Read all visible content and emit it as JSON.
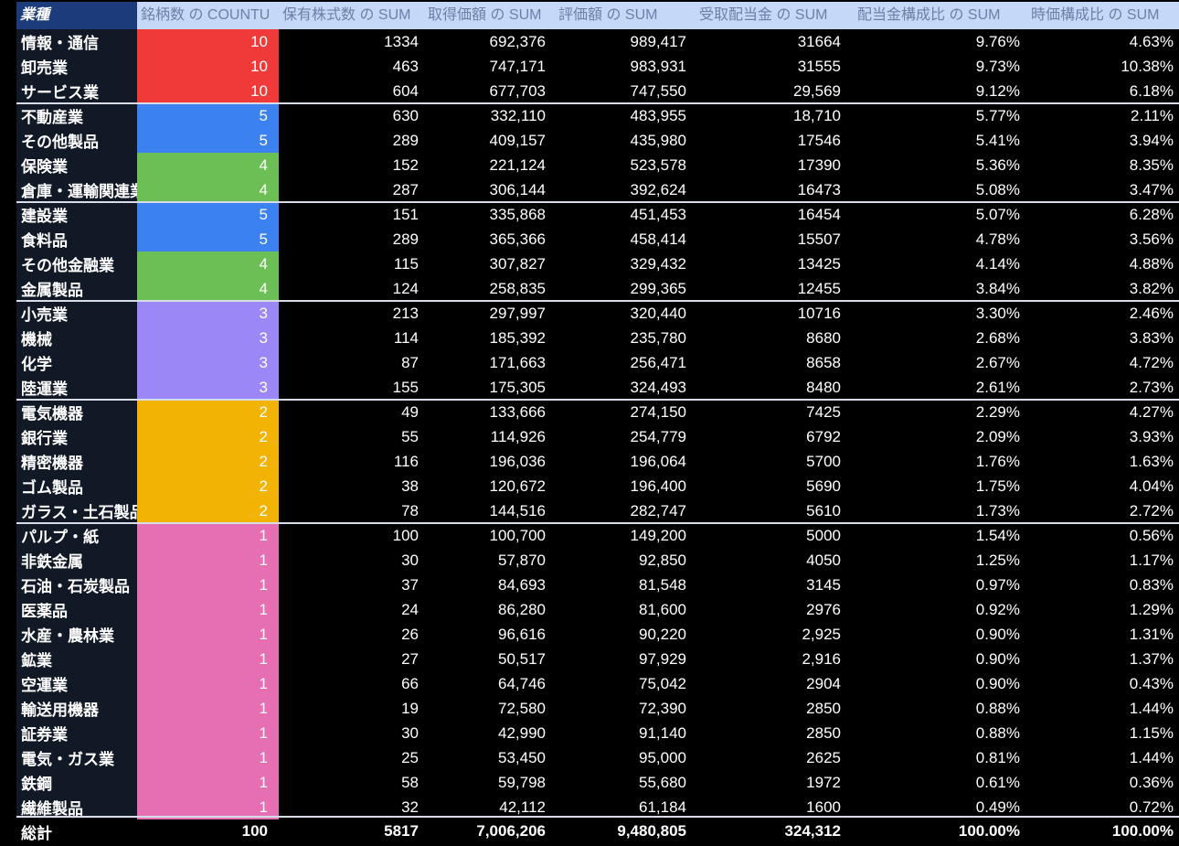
{
  "header": [
    "業種",
    "銘柄数 の COUNTU",
    "保有株式数 の SUM",
    "取得価額 の SUM",
    "評価額 の SUM",
    "受取配当金 の SUM",
    "配当金構成比 の SUM",
    "時価構成比 の SUM"
  ],
  "group_colors": {
    "10": "#f03a3a",
    "5": "#3b82f0",
    "4": "#6cbf54",
    "3": "#9b87f5",
    "2": "#f2b304",
    "1": "#e66fb4"
  },
  "rows": [
    {
      "sector": "情報・通信",
      "count": "10",
      "shares": "1334",
      "cost": "692,376",
      "value": "989,417",
      "dividend": "31664",
      "div_ratio": "9.76%",
      "mkt_ratio": "4.63%"
    },
    {
      "sector": "卸売業",
      "count": "10",
      "shares": "463",
      "cost": "747,171",
      "value": "983,931",
      "dividend": "31555",
      "div_ratio": "9.73%",
      "mkt_ratio": "10.38%"
    },
    {
      "sector": "サービス業",
      "count": "10",
      "shares": "604",
      "cost": "677,703",
      "value": "747,550",
      "dividend": "29,569",
      "div_ratio": "9.12%",
      "mkt_ratio": "6.18%"
    },
    {
      "sector": "不動産業",
      "count": "5",
      "shares": "630",
      "cost": "332,110",
      "value": "483,955",
      "dividend": "18,710",
      "div_ratio": "5.77%",
      "mkt_ratio": "2.11%"
    },
    {
      "sector": "その他製品",
      "count": "5",
      "shares": "289",
      "cost": "409,157",
      "value": "435,980",
      "dividend": "17546",
      "div_ratio": "5.41%",
      "mkt_ratio": "3.94%"
    },
    {
      "sector": "保険業",
      "count": "4",
      "shares": "152",
      "cost": "221,124",
      "value": "523,578",
      "dividend": "17390",
      "div_ratio": "5.36%",
      "mkt_ratio": "8.35%"
    },
    {
      "sector": "倉庫・運輸関連業",
      "count": "4",
      "shares": "287",
      "cost": "306,144",
      "value": "392,624",
      "dividend": "16473",
      "div_ratio": "5.08%",
      "mkt_ratio": "3.47%"
    },
    {
      "sector": "建設業",
      "count": "5",
      "shares": "151",
      "cost": "335,868",
      "value": "451,453",
      "dividend": "16454",
      "div_ratio": "5.07%",
      "mkt_ratio": "6.28%"
    },
    {
      "sector": "食料品",
      "count": "5",
      "shares": "289",
      "cost": "365,366",
      "value": "458,414",
      "dividend": "15507",
      "div_ratio": "4.78%",
      "mkt_ratio": "3.56%"
    },
    {
      "sector": "その他金融業",
      "count": "4",
      "shares": "115",
      "cost": "307,827",
      "value": "329,432",
      "dividend": "13425",
      "div_ratio": "4.14%",
      "mkt_ratio": "4.88%"
    },
    {
      "sector": "金属製品",
      "count": "4",
      "shares": "124",
      "cost": "258,835",
      "value": "299,365",
      "dividend": "12455",
      "div_ratio": "3.84%",
      "mkt_ratio": "3.82%"
    },
    {
      "sector": "小売業",
      "count": "3",
      "shares": "213",
      "cost": "297,997",
      "value": "320,440",
      "dividend": "10716",
      "div_ratio": "3.30%",
      "mkt_ratio": "2.46%"
    },
    {
      "sector": "機械",
      "count": "3",
      "shares": "114",
      "cost": "185,392",
      "value": "235,780",
      "dividend": "8680",
      "div_ratio": "2.68%",
      "mkt_ratio": "3.83%"
    },
    {
      "sector": "化学",
      "count": "3",
      "shares": "87",
      "cost": "171,663",
      "value": "256,471",
      "dividend": "8658",
      "div_ratio": "2.67%",
      "mkt_ratio": "4.72%"
    },
    {
      "sector": "陸運業",
      "count": "3",
      "shares": "155",
      "cost": "175,305",
      "value": "324,493",
      "dividend": "8480",
      "div_ratio": "2.61%",
      "mkt_ratio": "2.73%"
    },
    {
      "sector": "電気機器",
      "count": "2",
      "shares": "49",
      "cost": "133,666",
      "value": "274,150",
      "dividend": "7425",
      "div_ratio": "2.29%",
      "mkt_ratio": "4.27%"
    },
    {
      "sector": "銀行業",
      "count": "2",
      "shares": "55",
      "cost": "114,926",
      "value": "254,779",
      "dividend": "6792",
      "div_ratio": "2.09%",
      "mkt_ratio": "3.93%"
    },
    {
      "sector": "精密機器",
      "count": "2",
      "shares": "116",
      "cost": "196,036",
      "value": "196,064",
      "dividend": "5700",
      "div_ratio": "1.76%",
      "mkt_ratio": "1.63%"
    },
    {
      "sector": "ゴム製品",
      "count": "2",
      "shares": "38",
      "cost": "120,672",
      "value": "196,400",
      "dividend": "5690",
      "div_ratio": "1.75%",
      "mkt_ratio": "4.04%"
    },
    {
      "sector": "ガラス・土石製品",
      "count": "2",
      "shares": "78",
      "cost": "144,516",
      "value": "282,747",
      "dividend": "5610",
      "div_ratio": "1.73%",
      "mkt_ratio": "2.72%"
    },
    {
      "sector": "パルプ・紙",
      "count": "1",
      "shares": "100",
      "cost": "100,700",
      "value": "149,200",
      "dividend": "5000",
      "div_ratio": "1.54%",
      "mkt_ratio": "0.56%"
    },
    {
      "sector": "非鉄金属",
      "count": "1",
      "shares": "30",
      "cost": "57,870",
      "value": "92,850",
      "dividend": "4050",
      "div_ratio": "1.25%",
      "mkt_ratio": "1.17%"
    },
    {
      "sector": "石油・石炭製品",
      "count": "1",
      "shares": "37",
      "cost": "84,693",
      "value": "81,548",
      "dividend": "3145",
      "div_ratio": "0.97%",
      "mkt_ratio": "0.83%"
    },
    {
      "sector": "医薬品",
      "count": "1",
      "shares": "24",
      "cost": "86,280",
      "value": "81,600",
      "dividend": "2976",
      "div_ratio": "0.92%",
      "mkt_ratio": "1.29%"
    },
    {
      "sector": "水産・農林業",
      "count": "1",
      "shares": "26",
      "cost": "96,616",
      "value": "90,220",
      "dividend": "2,925",
      "div_ratio": "0.90%",
      "mkt_ratio": "1.31%"
    },
    {
      "sector": "鉱業",
      "count": "1",
      "shares": "27",
      "cost": "50,517",
      "value": "97,929",
      "dividend": "2,916",
      "div_ratio": "0.90%",
      "mkt_ratio": "1.37%"
    },
    {
      "sector": "空運業",
      "count": "1",
      "shares": "66",
      "cost": "64,746",
      "value": "75,042",
      "dividend": "2904",
      "div_ratio": "0.90%",
      "mkt_ratio": "0.43%"
    },
    {
      "sector": "輸送用機器",
      "count": "1",
      "shares": "19",
      "cost": "72,580",
      "value": "72,390",
      "dividend": "2850",
      "div_ratio": "0.88%",
      "mkt_ratio": "1.44%"
    },
    {
      "sector": "証券業",
      "count": "1",
      "shares": "30",
      "cost": "42,990",
      "value": "91,140",
      "dividend": "2850",
      "div_ratio": "0.88%",
      "mkt_ratio": "1.15%"
    },
    {
      "sector": "電気・ガス業",
      "count": "1",
      "shares": "25",
      "cost": "53,450",
      "value": "95,000",
      "dividend": "2625",
      "div_ratio": "0.81%",
      "mkt_ratio": "1.44%"
    },
    {
      "sector": "鉄鋼",
      "count": "1",
      "shares": "58",
      "cost": "59,798",
      "value": "55,680",
      "dividend": "1972",
      "div_ratio": "0.61%",
      "mkt_ratio": "0.36%"
    },
    {
      "sector": "繊維製品",
      "count": "1",
      "shares": "32",
      "cost": "42,112",
      "value": "61,184",
      "dividend": "1600",
      "div_ratio": "0.49%",
      "mkt_ratio": "0.72%"
    }
  ],
  "total": {
    "sector": "総計",
    "count": "100",
    "shares": "5817",
    "cost": "7,006,206",
    "value": "9,480,805",
    "dividend": "324,312",
    "div_ratio": "100.00%",
    "mkt_ratio": "100.00%"
  }
}
